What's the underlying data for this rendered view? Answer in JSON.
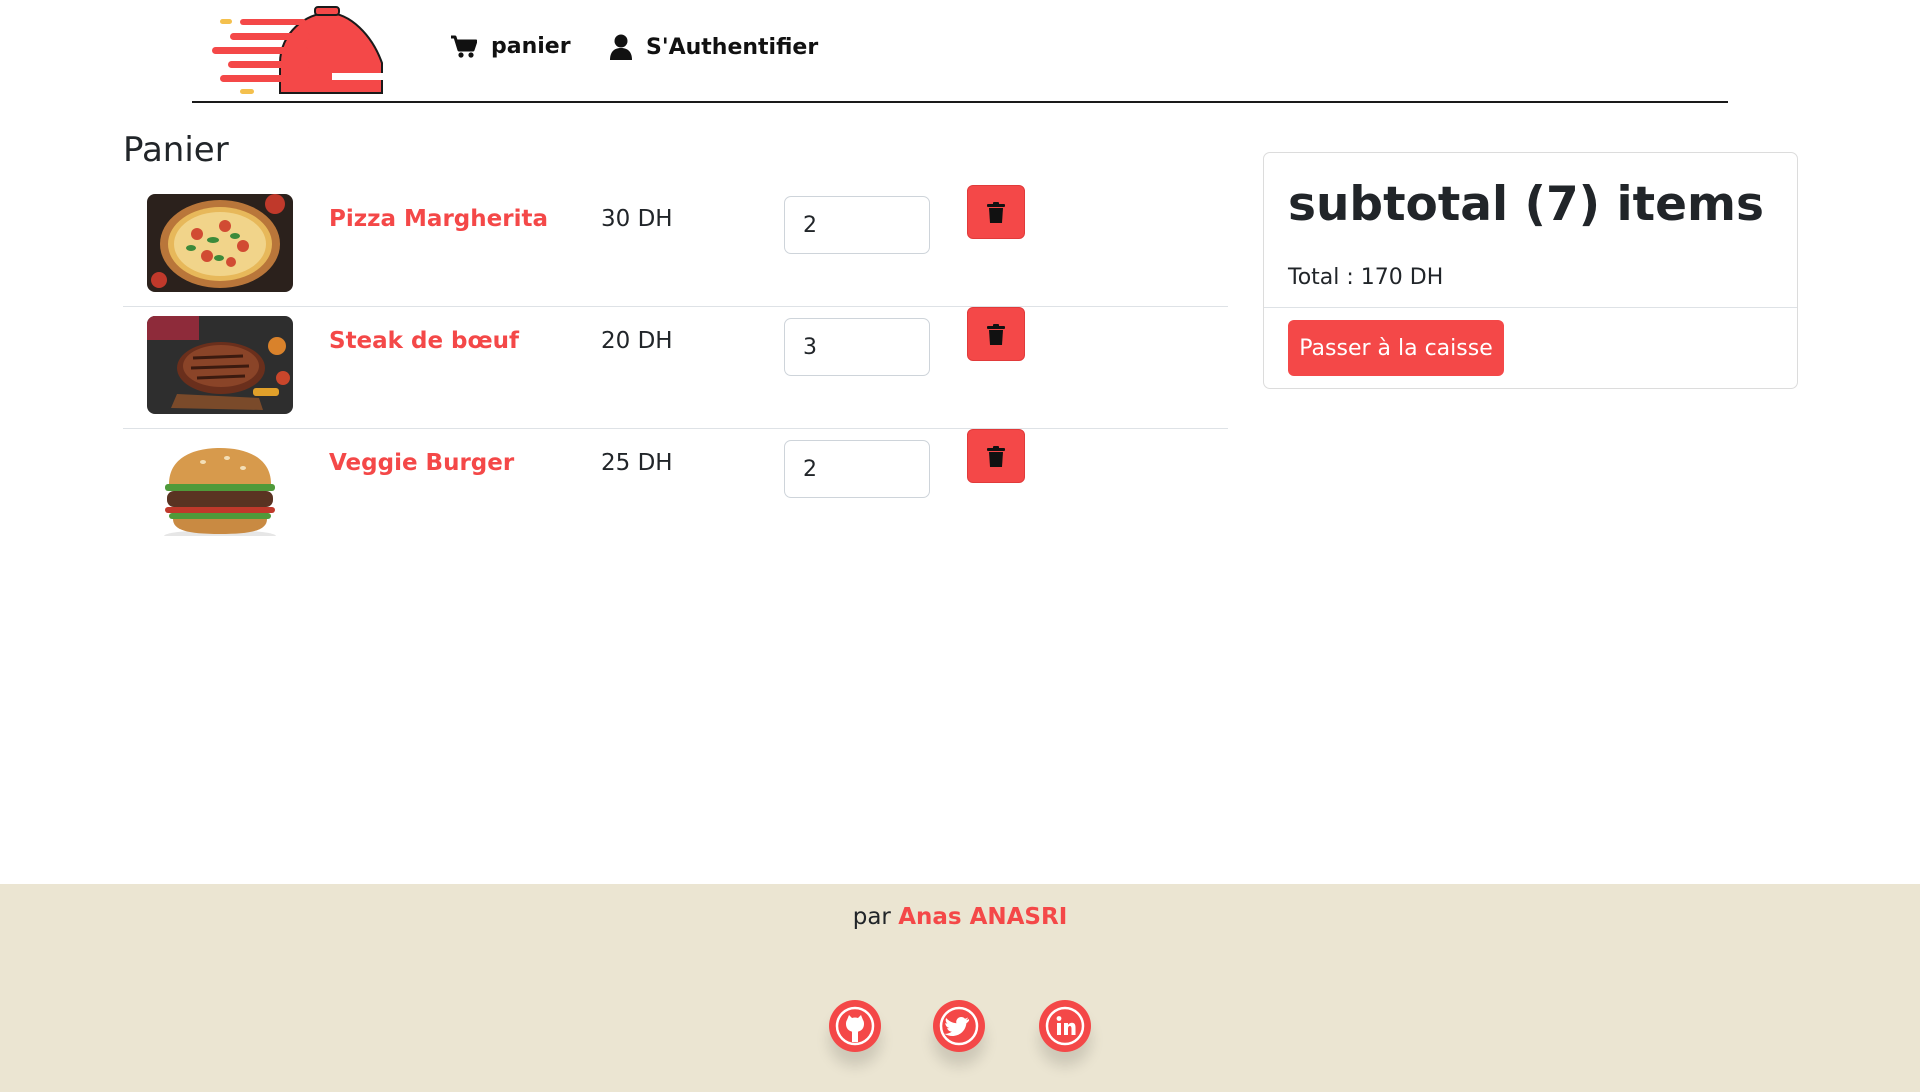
{
  "nav": {
    "cart_label": "panier",
    "auth_label": "S'Authentifier"
  },
  "cart": {
    "title": "Panier",
    "items": [
      {
        "name": "Pizza Margherita",
        "price": "30 DH",
        "quantity": "2",
        "image": "pizza"
      },
      {
        "name": "Steak de bœuf",
        "price": "20 DH",
        "quantity": "3",
        "image": "steak"
      },
      {
        "name": "Veggie Burger",
        "price": "25 DH",
        "quantity": "2",
        "image": "burger"
      }
    ]
  },
  "summary": {
    "heading": "subtotal (7) items",
    "total": "Total : 170 DH",
    "checkout_label": "Passer à la caisse"
  },
  "footer": {
    "prefix": "par",
    "author": "Anas ANASRI",
    "social": [
      "github-icon",
      "twitter-icon",
      "linkedin-icon"
    ]
  },
  "colors": {
    "accent": "#f44848",
    "footer_bg": "#ebe5d2"
  }
}
